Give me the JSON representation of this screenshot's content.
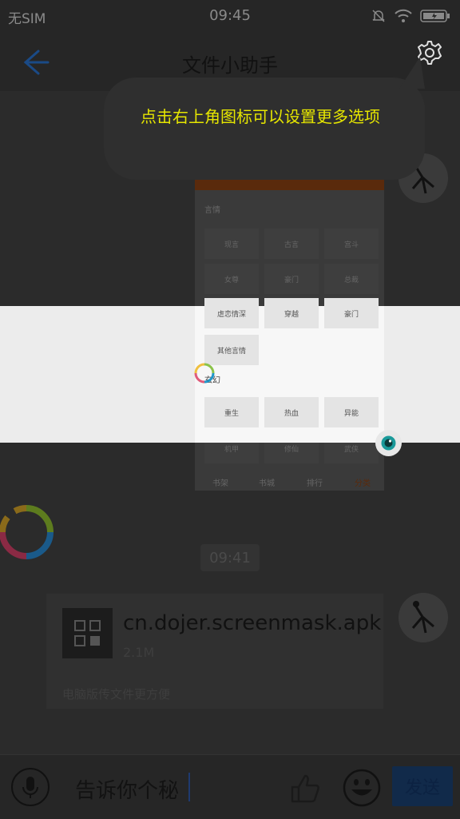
{
  "status": {
    "carrier": "无SIM",
    "time": "09:45"
  },
  "header": {
    "title": "文件小助手"
  },
  "tooltip": {
    "text": "点击右上角图标可以设置更多选项"
  },
  "preview": {
    "section1": "言情",
    "section2": "玄幻",
    "tiles1": [
      "现言",
      "古言",
      "宫斗",
      "女尊",
      "豪门",
      "总裁",
      "虐恋情深",
      "穿越",
      "豪门",
      "其他言情"
    ],
    "tiles2": [
      "重生",
      "热血",
      "异能",
      "机甲",
      "修仙",
      "武侠"
    ],
    "nav": [
      "书架",
      "书城",
      "排行",
      "分类"
    ]
  },
  "chat": {
    "timestamp": "09:41",
    "file": {
      "name": "cn.dojer.screenmask.apk",
      "size": "2.1M",
      "hint": "电脑版传文件更方便"
    }
  },
  "input": {
    "value": "告诉你个秘",
    "send_label": "发送"
  },
  "colors": {
    "tooltip_text": "#e6e600",
    "accent": "#1a6fd0"
  }
}
